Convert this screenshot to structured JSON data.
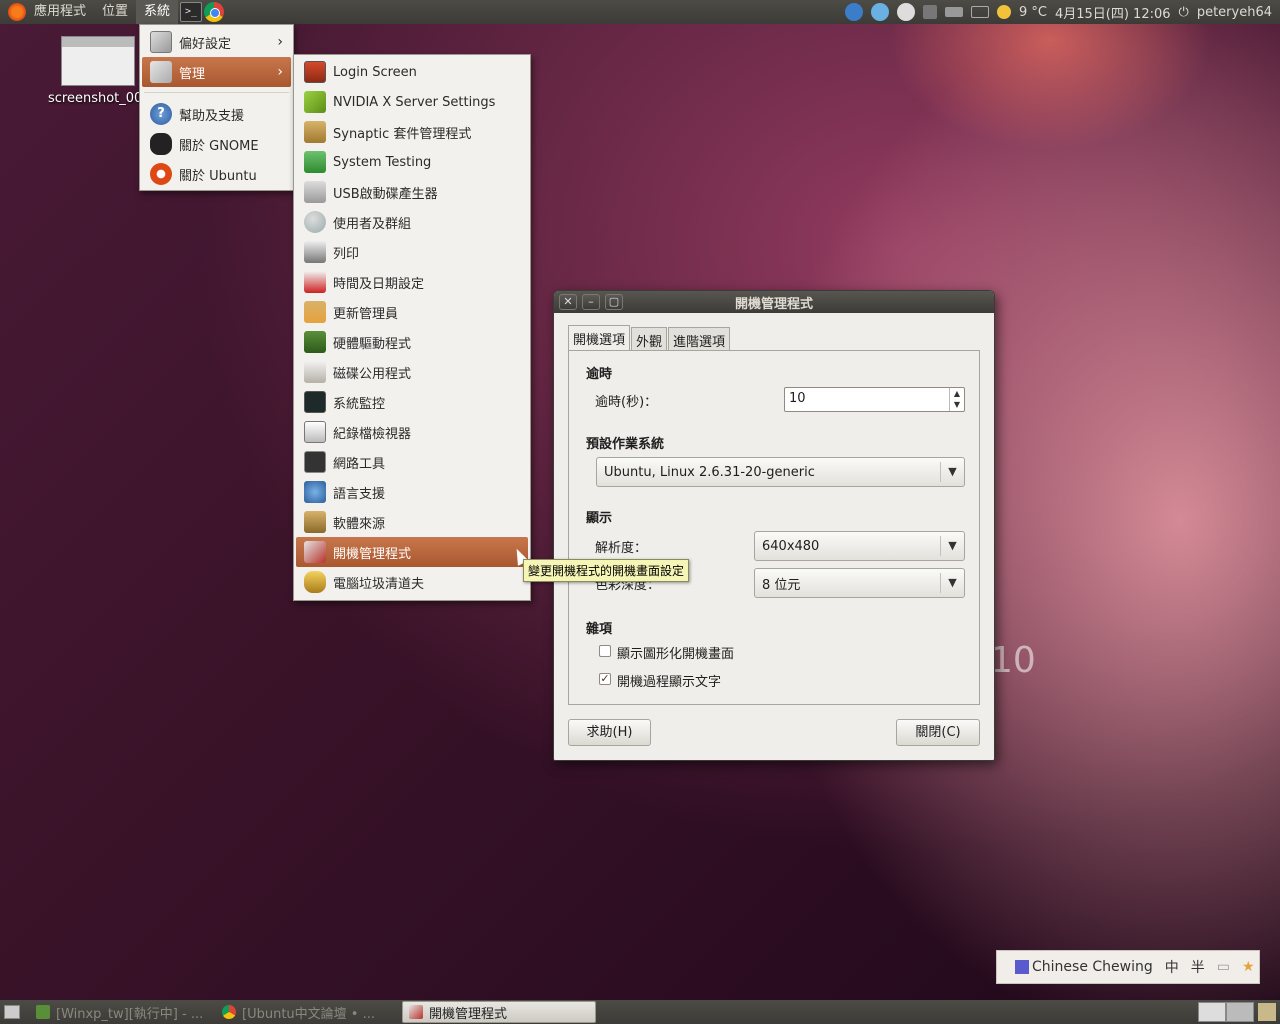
{
  "top_panel": {
    "menus": [
      "應用程式",
      "位置",
      "系統"
    ],
    "active_menu": "系統",
    "weather": "9 °C",
    "clock": "4月15日(四) 12:06",
    "user": "peteryeh64"
  },
  "desktop": {
    "icon_label": "screenshot_00"
  },
  "system_menu": {
    "items": [
      "偏好設定",
      "管理",
      "幫助及支援",
      "關於 GNOME",
      "關於 Ubuntu"
    ]
  },
  "admin_menu": {
    "items": [
      "Login Screen",
      "NVIDIA X Server Settings",
      "Synaptic 套件管理程式",
      "System Testing",
      "USB啟動碟產生器",
      "使用者及群組",
      "列印",
      "時間及日期設定",
      "更新管理員",
      "硬體驅動程式",
      "磁碟公用程式",
      "系統監控",
      "紀錄檔檢視器",
      "網路工具",
      "語言支援",
      "軟體來源",
      "開機管理程式",
      "電腦垃圾清道夫"
    ],
    "highlighted": "開機管理程式"
  },
  "tooltip": "變更開機程式的開機畫面設定",
  "dialog": {
    "title": "開機管理程式",
    "tabs": [
      "開機選項",
      "外觀",
      "進階選項"
    ],
    "active_tab": "開機選項",
    "timeout_section": "逾時",
    "timeout_label": "逾時(秒)：",
    "timeout_value": "10",
    "default_os_section": "預設作業系統",
    "default_os_value": "Ubuntu, Linux 2.6.31-20-generic",
    "display_section": "顯示",
    "resolution_label": "解析度：",
    "resolution_value": "640x480",
    "color_depth_label": "色彩深度：",
    "color_depth_value": "8 位元",
    "misc_section": "雜項",
    "show_splash_label": "顯示圖形化開機畫面",
    "show_splash_checked": false,
    "show_text_label": "開機過程顯示文字",
    "show_text_checked": true,
    "help_button": "求助(H)",
    "close_button": "關閉(C)"
  },
  "watermark": "10",
  "ime": {
    "name": "Chinese Chewing",
    "mode": "中",
    "width": "半"
  },
  "bottom_panel": {
    "tasks": [
      "[Winxp_tw][執行中] - ...",
      "[Ubuntu中文論壇 • ...",
      "開機管理程式"
    ],
    "active_task": "開機管理程式"
  }
}
